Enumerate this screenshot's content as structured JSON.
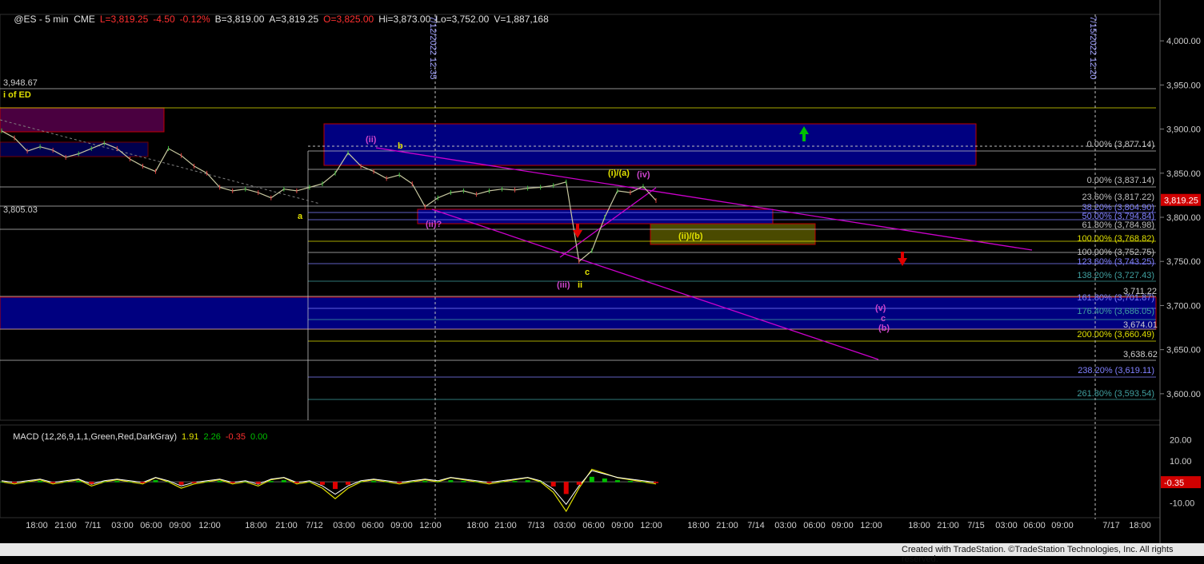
{
  "header": {
    "symbol": "@ES - 5 min  CME",
    "last": "L=3,819.25",
    "change": "-4.50",
    "change_pct": "-0.12%",
    "bid": "B=3,819.00",
    "ask": "A=3,819.25",
    "open": "O=3,825.00",
    "high": "Hi=3,873.00",
    "low": "Lo=3,752.00",
    "volume": "V=1,887,168"
  },
  "macd": {
    "label": "MACD (12,26,9,1,1,Green,Red,DarkGray)",
    "v1": "1.91",
    "v2": "2.26",
    "v3": "-0.35",
    "v4": "0.00",
    "current_tag": "-0.35"
  },
  "footer": {
    "credit": "Created with TradeStation. ©TradeStation Technologies, Inc. All rights reserved."
  },
  "colors": {
    "up": "#00c000",
    "down": "#e00000",
    "accent_box": "#000080",
    "magenta": "#cc00cc",
    "yellow": "#e0e000"
  },
  "chart_data": {
    "type": "line",
    "price_axis": {
      "ticks": [
        "4,000.00",
        "3,950.00",
        "3,900.00",
        "3,850.00",
        "3,800.00",
        "3,750.00",
        "3,700.00",
        "3,650.00",
        "3,600.00"
      ],
      "ylim": [
        3570,
        4030
      ],
      "current": "3,819.25"
    },
    "macd_axis": {
      "ticks": [
        "20.00",
        "10.00",
        "0.00",
        "-10.00"
      ],
      "ylim": [
        -14,
        24
      ]
    },
    "x_ticks": [
      "18:00",
      "21:00",
      "7/11",
      "03:00",
      "06:00",
      "09:00",
      "12:00",
      "18:00",
      "21:00",
      "7/12",
      "03:00",
      "06:00",
      "09:00",
      "12:00",
      "18:00",
      "21:00",
      "7/13",
      "03:00",
      "06:00",
      "09:00",
      "12:00",
      "18:00",
      "21:00",
      "7/14",
      "03:00",
      "06:00",
      "09:00",
      "12:00",
      "18:00",
      "21:00",
      "7/15",
      "03:00",
      "06:00",
      "09:00",
      "7/17",
      "18:00"
    ],
    "vertical_markers": [
      "7/12/2022 12:35",
      "7/15/2022 12:20"
    ],
    "price_labels": [
      "3,948.67",
      "3,805.03",
      "3,711.22",
      "3,674.01",
      "3,638.62"
    ],
    "fib_labels": [
      {
        "text": "0.00% (3,877.14)",
        "color": "#c0c0c0"
      },
      {
        "text": "0.00% (3,837.14)",
        "color": "#c0c0c0"
      },
      {
        "text": "23.60% (3,817.22)",
        "color": "#c0c0c0"
      },
      {
        "text": "38.20% (3,804.90)",
        "color": "#8080ff"
      },
      {
        "text": "50.00% (3,794.84)",
        "color": "#8080ff"
      },
      {
        "text": "61.80% (3,784.98)",
        "color": "#c0c0c0"
      },
      {
        "text": "100.00% (3,768.82)",
        "color": "#e0e000"
      },
      {
        "text": "100.00% (3,752.75)",
        "color": "#c0c0c0"
      },
      {
        "text": "123.60% (3,743.25)",
        "color": "#8080ff"
      },
      {
        "text": "138.20% (3,727.43)",
        "color": "#40a0a0"
      },
      {
        "text": "161.80% (3,701.87)",
        "color": "#8080ff"
      },
      {
        "text": "176.40% (3,686.05)",
        "color": "#40a0a0"
      },
      {
        "text": "200.00% (3,660.49)",
        "color": "#e0e000"
      },
      {
        "text": "238.20% (3,619.11)",
        "color": "#8080ff"
      },
      {
        "text": "261.80% (3,593.54)",
        "color": "#40a0a0"
      }
    ],
    "wave_labels": [
      {
        "text": "i of ED",
        "color": "#e0e000"
      },
      {
        "text": "(ii)",
        "color": "#cc44cc"
      },
      {
        "text": "b",
        "color": "#e0e000"
      },
      {
        "text": "a",
        "color": "#e0e000"
      },
      {
        "text": "(ii)?",
        "color": "#cc44cc"
      },
      {
        "text": "(i)/(a)",
        "color": "#e0e000"
      },
      {
        "text": "(iv)",
        "color": "#cc44cc"
      },
      {
        "text": "(ii)/(b)",
        "color": "#e0e000"
      },
      {
        "text": "c",
        "color": "#e0e000"
      },
      {
        "text": "(iii)",
        "color": "#cc44cc"
      },
      {
        "text": "ii",
        "color": "#e0e000"
      },
      {
        "text": "(v)",
        "color": "#cc44cc"
      },
      {
        "text": "c",
        "color": "#cc44cc"
      },
      {
        "text": "(b)",
        "color": "#cc44cc"
      }
    ],
    "series": [
      {
        "name": "price",
        "values": [
          3898,
          3890,
          3875,
          3880,
          3876,
          3868,
          3872,
          3878,
          3884,
          3878,
          3866,
          3858,
          3852,
          3878,
          3870,
          3858,
          3850,
          3834,
          3830,
          3832,
          3828,
          3822,
          3832,
          3830,
          3834,
          3838,
          3850,
          3873,
          3858,
          3852,
          3844,
          3848,
          3838,
          3812,
          3822,
          3828,
          3830,
          3826,
          3830,
          3832,
          3831,
          3833,
          3834,
          3836,
          3840,
          3750,
          3762,
          3800,
          3830,
          3828,
          3835,
          3819
        ]
      },
      {
        "name": "macd",
        "values": [
          0,
          -1,
          0,
          1,
          -1,
          0,
          1,
          -2,
          0,
          1,
          0,
          -1,
          2,
          0,
          -3,
          -1,
          0,
          1,
          -1,
          0,
          -2,
          1,
          2,
          -1,
          0,
          -3,
          -8,
          -3,
          0,
          1,
          0,
          -1,
          0,
          1,
          0,
          2,
          1,
          0,
          -1,
          0,
          1,
          2,
          0,
          -5,
          -14,
          -3,
          6,
          4,
          2,
          1,
          0,
          -1
        ]
      }
    ]
  }
}
